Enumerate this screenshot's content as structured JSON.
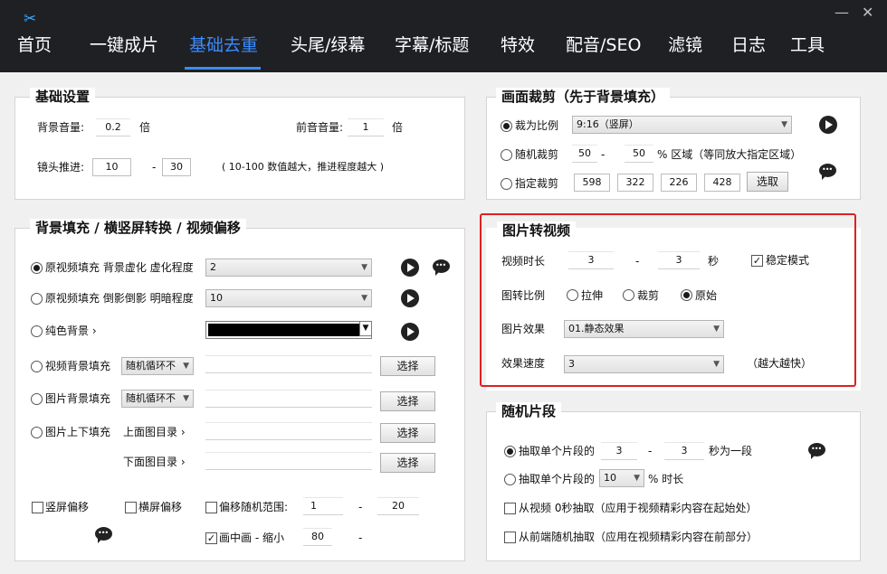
{
  "nav": {
    "tabs": [
      "首页",
      "一键成片",
      "基础去重",
      "头尾/绿幕",
      "字幕/标题",
      "特效",
      "配音/SEO",
      "滤镜",
      "日志",
      "工具"
    ],
    "active": "基础去重",
    "minimize": "—",
    "close": "✕"
  },
  "basic": {
    "title": "基础设置",
    "bg_volume_label": "背景音量:",
    "bg_volume": "0.2",
    "bg_volume_unit": "倍",
    "fg_volume_label": "前音音量:",
    "fg_volume": "1",
    "fg_volume_unit": "倍",
    "push_label": "镜头推进:",
    "push_min": "10",
    "push_dash": "-",
    "push_max": "30",
    "push_hint": "( 10-100 数值越大，推进程度越大 )"
  },
  "fill": {
    "title": "背景填充 /  横竖屏转换 / 视频偏移",
    "row1_label": "原视频填充 背景虚化 虚化程度",
    "row1_value": "2",
    "row2_label": "原视频填充 倒影倒影 明暗程度",
    "row2_value": "10",
    "row3_label": "纯色背景 ›",
    "row4_label": "视频背景填充",
    "row4_select": "随机循环不",
    "row5_label": "图片背景填充",
    "row5_select": "随机循环不",
    "row6_label": "图片上下填充",
    "top_dir_label": "上面图目录 ›",
    "bottom_dir_label": "下面图目录 ›",
    "choose": "选择",
    "vertical_offset": "竖屏偏移",
    "horizontal_offset": "横屏偏移",
    "random_offset": "偏移随机范围:",
    "offset_min": "1",
    "offset_dash": "-",
    "offset_max": "20",
    "pip_label": "画中画 - 缩小",
    "pip_value": "80",
    "pip_dash": "-"
  },
  "crop": {
    "title": "画面裁剪（先于背景填充）",
    "ratio_label": "裁为比例",
    "ratio_value": "9:16（竖屏）",
    "random_label": "随机裁剪",
    "random_min": "50",
    "random_dash": "-",
    "random_max": "50",
    "random_unit": "% 区域（等同放大指定区域）",
    "fixed_label": "指定裁剪",
    "fixed_values": [
      "598",
      "322",
      "226",
      "428"
    ],
    "pick": "选取"
  },
  "img2video": {
    "title": "图片转视频",
    "duration_label": "视频时长",
    "duration_min": "3",
    "duration_dash": "-",
    "duration_max": "3",
    "duration_unit": "秒",
    "stable_label": "稳定模式",
    "ratio_label": "图转比例",
    "ratio_options": [
      "拉伸",
      "裁剪",
      "原始"
    ],
    "effect_label": "图片效果",
    "effect_value": "01.静态效果",
    "speed_label": "效果速度",
    "speed_value": "3",
    "speed_hint": "（越大越快）"
  },
  "random_clip": {
    "title": "随机片段",
    "row1_label": "抽取单个片段的",
    "row1_min": "3",
    "row1_dash": "-",
    "row1_max": "3",
    "row1_unit": "秒为一段",
    "row2_label": "抽取单个片段的",
    "row2_value": "10",
    "row2_unit": "% 时长",
    "row3_label": "从视频 0秒抽取（应用于视频精彩内容在起始处）",
    "row4_label": "从前端随机抽取（应用在视频精彩内容在前部分）"
  },
  "checkmark": "✓",
  "icons": {
    "logo": "scissors-icon",
    "play": "play-icon",
    "chat": "chat-icon",
    "dropdown": "chevron-down-icon"
  }
}
